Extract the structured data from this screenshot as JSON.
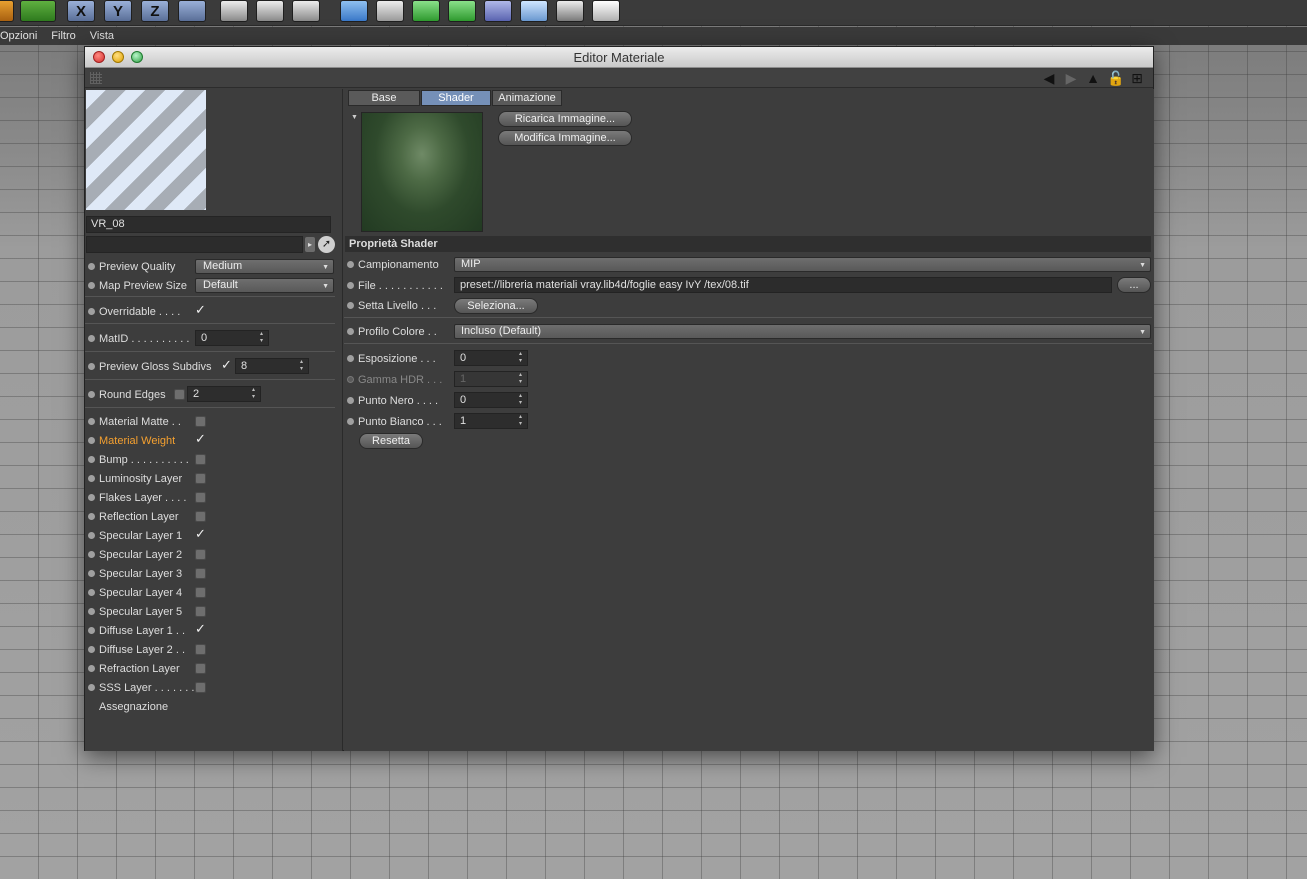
{
  "toolbar": {
    "axis_buttons": [
      "X",
      "Y",
      "Z"
    ]
  },
  "menubar": {
    "items": [
      "Opzioni",
      "Filtro",
      "Vista"
    ]
  },
  "window": {
    "title": "Editor Materiale"
  },
  "left": {
    "material_name": "VR_08",
    "preview_quality_label": "Preview Quality",
    "preview_quality_value": "Medium",
    "map_preview_size_label": "Map Preview Size",
    "map_preview_size_value": "Default",
    "overridable_label": "Overridable . . . .",
    "matid_label": "MatID . . . . . . . . . .",
    "matid_value": "0",
    "preview_gloss_label": "Preview Gloss Subdivs",
    "preview_gloss_value": "8",
    "round_edges_label": "Round Edges",
    "round_edges_value": "2",
    "layers": [
      {
        "label": "Material Matte . .",
        "checked": false,
        "active": false
      },
      {
        "label": "Material Weight",
        "checked": true,
        "active": true
      },
      {
        "label": "Bump . . . . . . . . . .",
        "checked": false,
        "active": false
      },
      {
        "label": "Luminosity Layer",
        "checked": false,
        "active": false
      },
      {
        "label": "Flakes Layer . . . .",
        "checked": false,
        "active": false
      },
      {
        "label": "Reflection Layer",
        "checked": false,
        "active": false
      },
      {
        "label": "Specular Layer 1",
        "checked": true,
        "active": false
      },
      {
        "label": "Specular Layer 2",
        "checked": false,
        "active": false
      },
      {
        "label": "Specular Layer 3",
        "checked": false,
        "active": false
      },
      {
        "label": "Specular Layer 4",
        "checked": false,
        "active": false
      },
      {
        "label": "Specular Layer 5",
        "checked": false,
        "active": false
      },
      {
        "label": "Diffuse Layer 1 . .",
        "checked": true,
        "active": false
      },
      {
        "label": "Diffuse Layer 2 . .",
        "checked": false,
        "active": false
      },
      {
        "label": "Refraction Layer",
        "checked": false,
        "active": false
      },
      {
        "label": "SSS Layer . . . . . . .",
        "checked": false,
        "active": false
      }
    ],
    "assignment_label": "Assegnazione"
  },
  "right": {
    "tabs": [
      "Base",
      "Shader",
      "Animazione"
    ],
    "active_tab": "Shader",
    "reload_image_label": "Ricarica Immagine...",
    "edit_image_label": "Modifica Immagine...",
    "section_title": "Proprietà Shader",
    "sampling_label": "Campionamento",
    "sampling_value": "MIP",
    "file_label": "File . . . . . . . . . . .",
    "file_value": "preset://libreria materiali vray.lib4d/foglie easy IvY /tex/08.tif",
    "file_browse_label": "...",
    "layer_set_label": "Setta Livello . . .",
    "select_label": "Seleziona...",
    "color_profile_label": "Profilo Colore . .",
    "color_profile_value": "Incluso (Default)",
    "exposure_label": "Esposizione . . .",
    "exposure_value": "0",
    "gamma_label": "Gamma HDR . . .",
    "gamma_value": "1",
    "black_point_label": "Punto Nero . . . .",
    "black_point_value": "0",
    "white_point_label": "Punto Bianco . . .",
    "white_point_value": "1",
    "reset_label": "Resetta"
  }
}
